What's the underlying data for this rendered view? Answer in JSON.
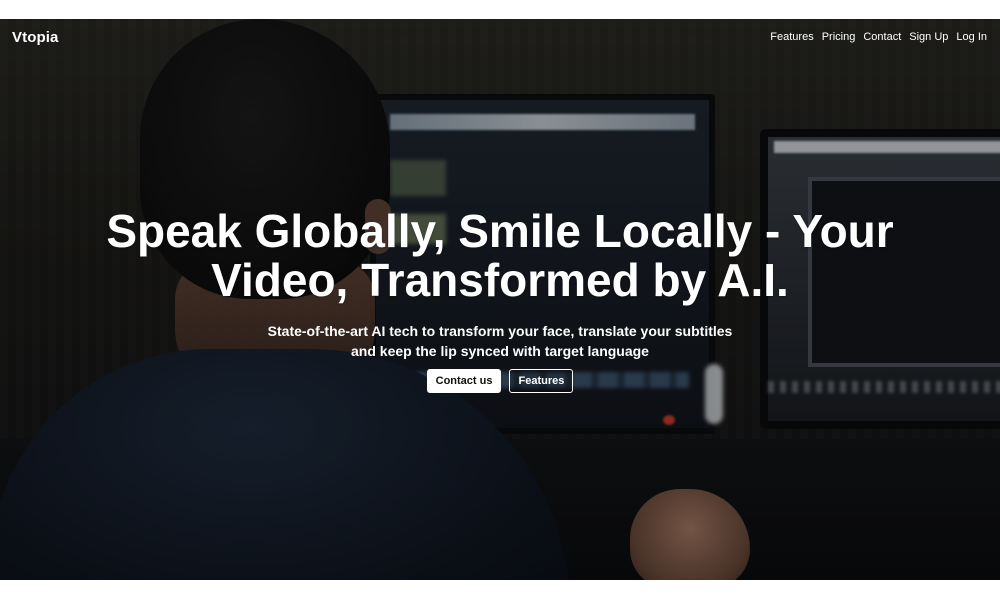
{
  "brand": {
    "name": "Vtopia"
  },
  "nav": {
    "links": [
      "Features",
      "Pricing",
      "Contact",
      "Sign Up",
      "Log In"
    ]
  },
  "hero": {
    "headline_line1": "Speak Globally, Smile Locally - Your",
    "headline_line2": "Video, Transformed by A.I.",
    "subhead_line1": "State-of-the-art AI tech to transform your face, translate your subtitles",
    "subhead_line2": "and keep the lip synced with target language",
    "primary_button": "Contact us",
    "secondary_button": "Features"
  },
  "colors": {
    "text": "#ffffff",
    "primary_button_bg": "#ffffff",
    "primary_button_text": "#111111",
    "overlay": "#000000"
  }
}
